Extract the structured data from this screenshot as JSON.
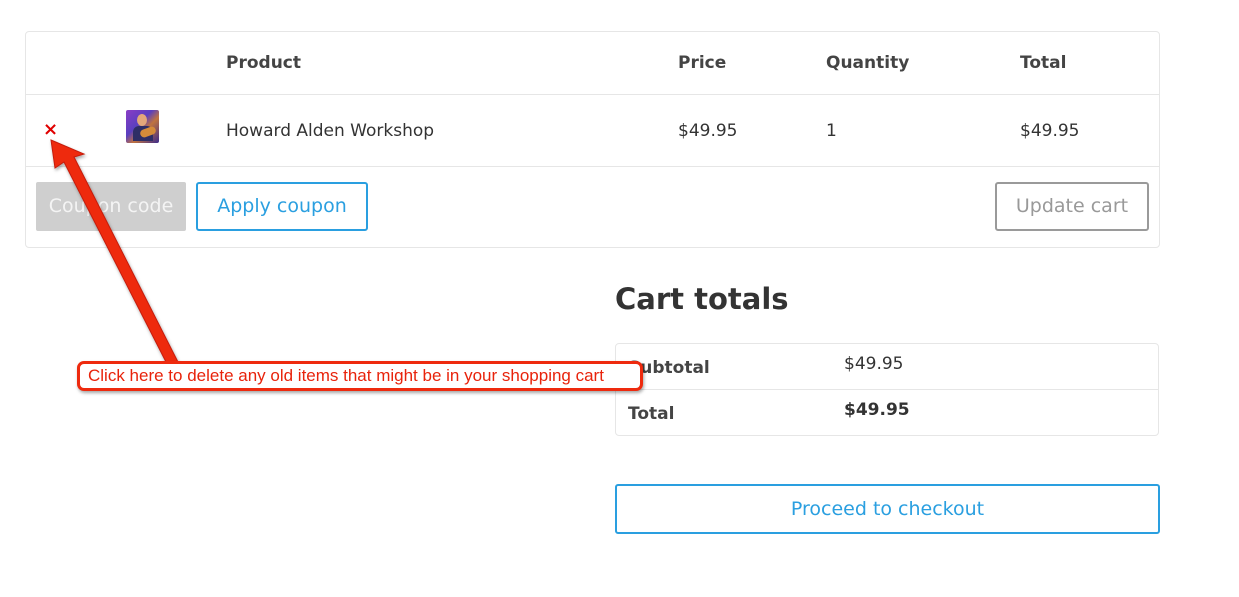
{
  "cart": {
    "headers": {
      "product": "Product",
      "price": "Price",
      "quantity": "Quantity",
      "total": "Total"
    },
    "items": [
      {
        "remove_icon": "×",
        "thumbnail_icon": "guitarist-photo-thumbnail",
        "product": "Howard Alden Workshop",
        "price": "$49.95",
        "quantity": "1",
        "total": "$49.95"
      }
    ],
    "coupon_placeholder": "Coupon code",
    "apply_coupon_label": "Apply coupon",
    "update_cart_label": "Update cart"
  },
  "totals": {
    "title": "Cart totals",
    "subtotal_label": "Subtotal",
    "subtotal_value": "$49.95",
    "total_label": "Total",
    "total_value": "$49.95",
    "checkout_label": "Proceed to checkout"
  },
  "annotation": {
    "text": "Click here to delete any old items that might be in your shopping cart",
    "color": "#ee2a0e"
  },
  "colors": {
    "accent_blue": "#2a9fe0",
    "remove_red": "#e00000"
  }
}
